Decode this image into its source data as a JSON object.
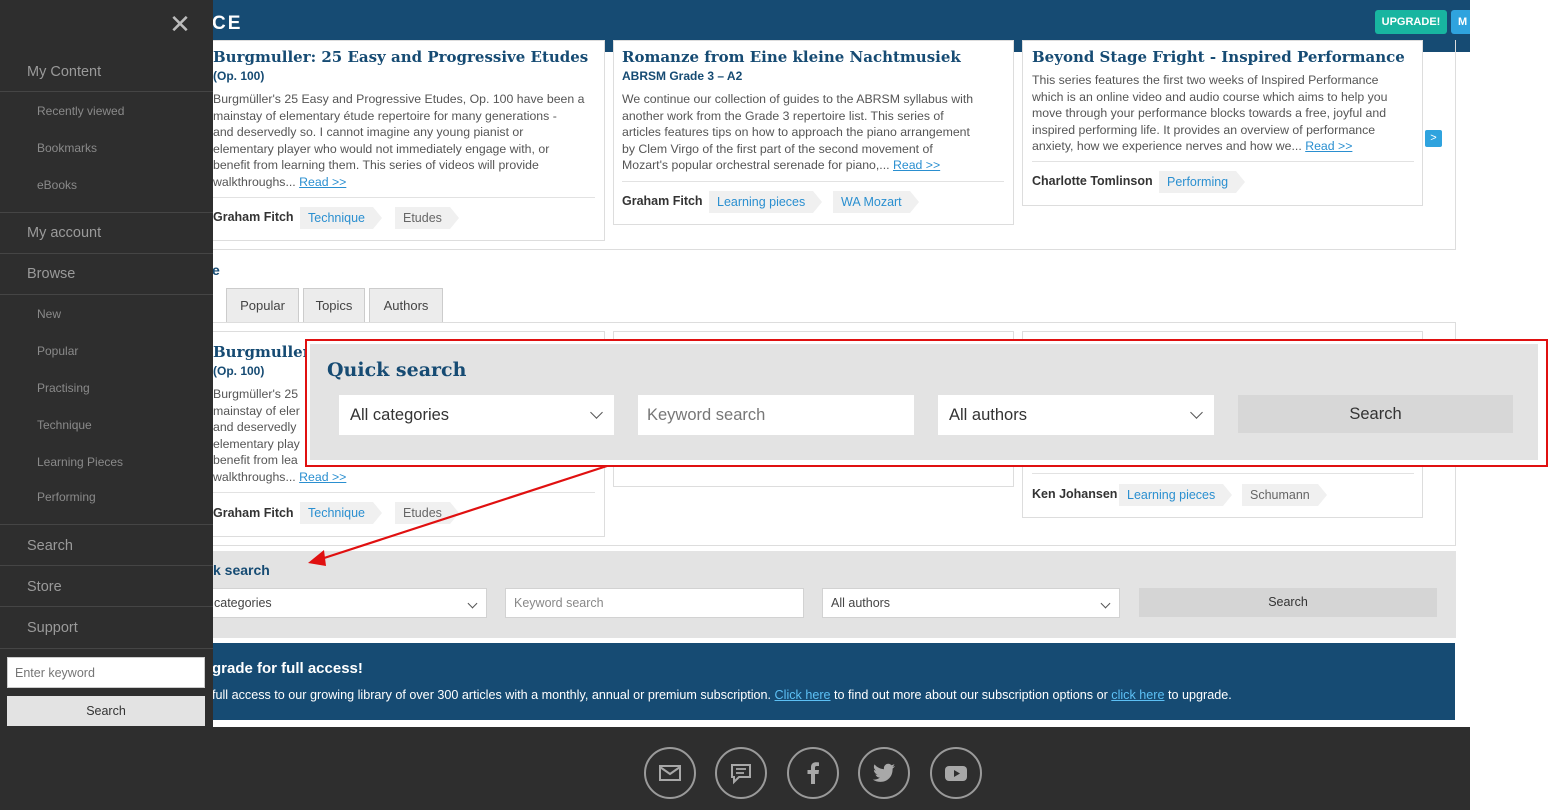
{
  "header": {
    "logo_text": "CE",
    "upgrade_label": "UPGRADE!",
    "menu_label": "M"
  },
  "featured": [
    {
      "title": "Burgmuller: 25 Easy and Progressive Etudes",
      "subtitle": "(Op. 100)",
      "desc_lines": [
        "Burgmüller's 25 Easy and Progressive Etudes, Op. 100 have been a",
        "mainstay of elementary étude repertoire for many generations -",
        "and deservedly so. I cannot imagine any young pianist or",
        "elementary player who would not immediately engage with, or",
        "benefit from learning them. This series of videos will provide",
        "walkthroughs..."
      ],
      "read_more": "Read >>",
      "author": "Graham Fitch",
      "tags": [
        "Technique",
        "Etudes"
      ]
    },
    {
      "title": "Romanze from Eine kleine Nachtmusiek",
      "subtitle": "ABRSM Grade 3 – A2",
      "desc_lines": [
        "We continue our collection of guides to the ABRSM syllabus with",
        "another work from the Grade 3 repertoire list. This series of",
        "articles features tips on how to approach the piano arrangement",
        "by Clem Virgo of the first part of the second movement of",
        "Mozart's popular orchestral serenade for piano,..."
      ],
      "read_more": "Read >>",
      "author": "Graham Fitch",
      "tags": [
        "Learning pieces",
        "WA Mozart"
      ]
    },
    {
      "title": "Beyond Stage Fright - Inspired Performance",
      "desc_lines": [
        "This series features the first two weeks of Inspired Performance",
        "which is an online video and audio course which aims to help you",
        "move through your performance blocks towards a free, joyful and",
        "inspired performing life. It provides an overview of performance",
        "anxiety, how we experience nerves and how we..."
      ],
      "read_more": "Read >>",
      "author": "Charlotte Tomlinson",
      "tags": [
        "Performing"
      ]
    }
  ],
  "browse": {
    "title": "e",
    "tabs": [
      "Popular",
      "Topics",
      "Authors"
    ],
    "card1": {
      "title": "Burgmuller: 2",
      "subtitle": "(Op. 100)",
      "desc_lines": [
        "Burgmüller's 25",
        "mainstay of eler",
        "and deservedly",
        "elementary play",
        "benefit from lea",
        "walkthroughs..."
      ],
      "read_more": "Read >>",
      "author": "Graham Fitch",
      "tags": [
        "Technique",
        "Etudes"
      ]
    },
    "card3": {
      "author": "Ken Johansen",
      "tags": [
        "Learning pieces",
        "Schumann"
      ]
    }
  },
  "quick_search": {
    "title": "k search",
    "category_value": "categories",
    "keyword_placeholder": "Keyword search",
    "author_value": "All authors",
    "search_label": "Search"
  },
  "upgrade_band": {
    "title": "grade for full access!",
    "text_before": "full access to our growing library of over 300 articles with a monthly, annual or premium subscription. ",
    "link1": "Click here",
    "text_middle": " to find out more about our subscription options or ",
    "link2": "click here",
    "text_after": " to upgrade."
  },
  "footer": {
    "icons": [
      "mail-icon",
      "chat-icon",
      "facebook-icon",
      "twitter-icon",
      "youtube-icon"
    ]
  },
  "sidebar": {
    "close_symbol": "✕",
    "my_content": "My Content",
    "content_items": [
      "Recently viewed",
      "Bookmarks",
      "eBooks"
    ],
    "my_account": "My account",
    "browse": "Browse",
    "browse_items": [
      "New",
      "Popular",
      "Practising",
      "Technique",
      "Learning Pieces",
      "Performing"
    ],
    "search": "Search",
    "store": "Store",
    "support": "Support",
    "keyword_placeholder": "Enter keyword",
    "search_button": "Search"
  },
  "zoom_callout": {
    "title": "Quick search",
    "category_value": "All categories",
    "keyword_placeholder": "Keyword search",
    "author_value": "All authors",
    "search_label": "Search"
  },
  "colors": {
    "brand_navy": "#164b73",
    "accent_teal": "#18b5a0",
    "link_blue": "#2a8fd0",
    "callout_red": "#e01010",
    "sidebar_bg": "#2e2e2e"
  }
}
